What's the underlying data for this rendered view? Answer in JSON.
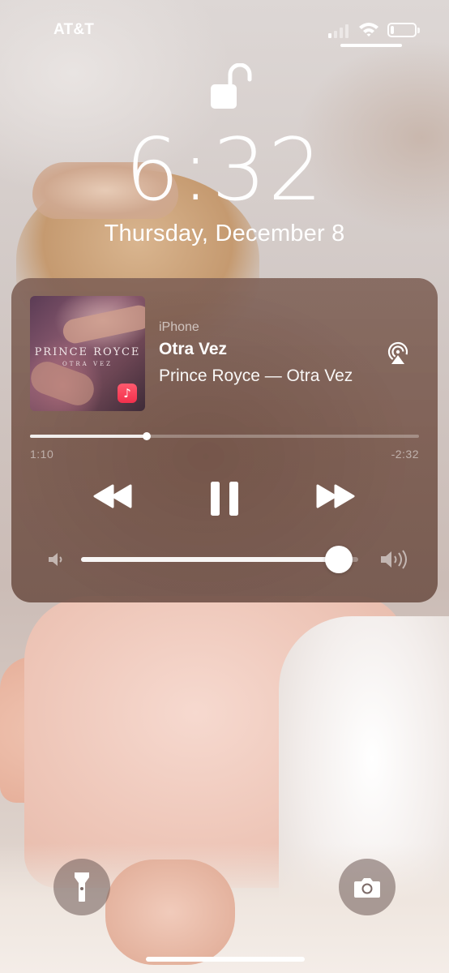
{
  "status_bar": {
    "carrier": "AT&T",
    "battery_level": 0.15
  },
  "lock_screen": {
    "time": "6:32",
    "date": "Thursday, December 8",
    "lock_state": "unlocked"
  },
  "now_playing": {
    "source": "iPhone",
    "title": "Otra Vez",
    "artist_album": "Prince Royce — Otra Vez",
    "album_art": {
      "artist_text": "PRINCE ROYCE",
      "album_text": "OTRA VEZ"
    },
    "elapsed": "1:10",
    "remaining": "-2:32",
    "progress": 0.3,
    "volume": 0.93,
    "is_playing": true
  },
  "quick_actions": {
    "left_icon": "flashlight-icon",
    "right_icon": "camera-icon"
  },
  "colors": {
    "player_bg": "#785a4e",
    "music_badge": "#f2304c"
  }
}
